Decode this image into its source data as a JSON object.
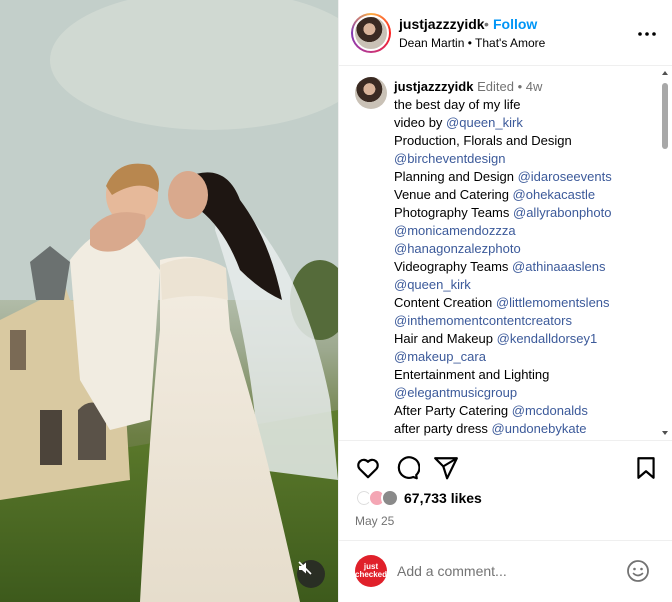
{
  "post": {
    "username": "justjazzzyidk",
    "separator": "•",
    "follow_label": "Follow",
    "audio": "Dean Martin • That's Amore"
  },
  "caption": {
    "username": "justjazzzyidk",
    "meta": "Edited • 4w",
    "lines": [
      {
        "text": "the best day of my life",
        "link": ""
      },
      {
        "text": "video by ",
        "link": "@queen_kirk"
      },
      {
        "text": "Production, Florals and Design",
        "link": ""
      },
      {
        "text": "",
        "link": "@bircheventdesign"
      },
      {
        "text": "Planning and Design ",
        "link": "@idaroseevents"
      },
      {
        "text": "Venue and Catering ",
        "link": "@ohekacastle"
      },
      {
        "text": "Photography Teams ",
        "link": "@allyrabonphoto"
      },
      {
        "text": "",
        "link": "@monicamendozzza"
      },
      {
        "text": "",
        "link": "@hanagonzalezphoto"
      },
      {
        "text": "Videography Teams ",
        "link": "@athinaaaslens"
      },
      {
        "text": "",
        "link": "@queen_kirk"
      },
      {
        "text": "Content Creation ",
        "link": "@littlemomentslens"
      },
      {
        "text": "",
        "link": "@inthemomentcontentcreators"
      },
      {
        "text": "Hair and Makeup ",
        "link": "@kendalldorsey1"
      },
      {
        "text": "",
        "link": "@makeup_cara"
      },
      {
        "text": "Entertainment and Lighting",
        "link": ""
      },
      {
        "text": "",
        "link": "@elegantmusicgroup"
      },
      {
        "text": "After Party Catering ",
        "link": "@mcdonalds"
      },
      {
        "text": "after party dress ",
        "link": "@undonebykate"
      }
    ]
  },
  "engagement": {
    "likes": "67,733 likes",
    "date": "May 25"
  },
  "comment": {
    "placeholder": "Add a comment...",
    "avatar_text": "just checked"
  },
  "icons": {
    "like": "heart-icon",
    "comment": "comment-icon",
    "share": "send-icon",
    "save": "bookmark-icon",
    "more": "more-icon",
    "mute": "muted-speaker-icon",
    "emoji": "emoji-icon"
  },
  "colors": {
    "accent": "#0095f6",
    "link": "#3c5a9a",
    "muted": "#737373"
  }
}
